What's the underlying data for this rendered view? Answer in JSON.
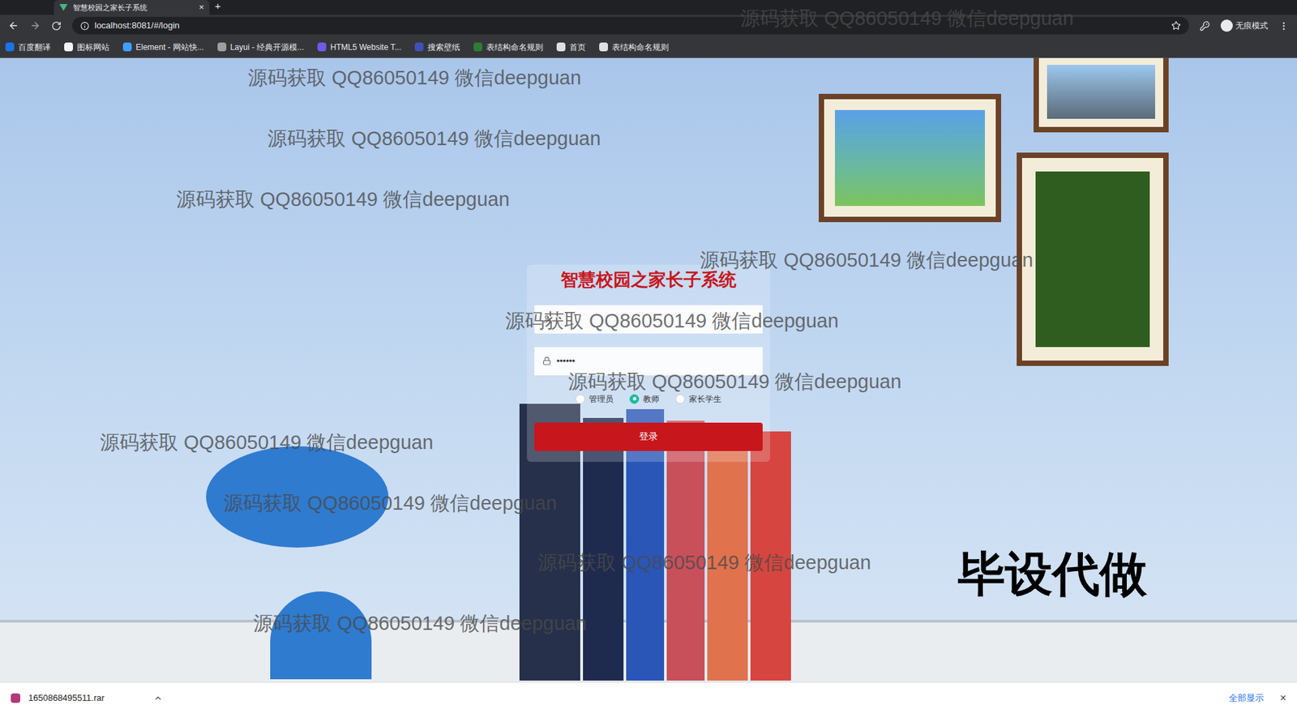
{
  "browser": {
    "tab_title": "智慧校园之家长子系统",
    "tab_close": "×",
    "new_tab": "+",
    "url": "localhost:8081/#/login",
    "profile": "无痕模式"
  },
  "bookmarks": [
    {
      "label": "百度翻译",
      "color": "#1a73e8"
    },
    {
      "label": "图标网站",
      "color": "#f5f5f5"
    },
    {
      "label": "Element - 网站快...",
      "color": "#409eff"
    },
    {
      "label": "Layui - 经典开源模...",
      "color": "#9e9e9e"
    },
    {
      "label": "HTML5 Website T...",
      "color": "#6c5ce7"
    },
    {
      "label": "搜索壁纸",
      "color": "#3f51b5"
    },
    {
      "label": "表结构命名规则",
      "color": "#2e7d32"
    },
    {
      "label": "首页",
      "color": "#e0e0e0"
    },
    {
      "label": "表结构命名规则",
      "color": "#e0e0e0"
    }
  ],
  "login": {
    "title": "智慧校园之家长子系统",
    "password_mask": "••••••",
    "roles": [
      {
        "label": "管理员",
        "selected": false
      },
      {
        "label": "教师",
        "selected": true
      },
      {
        "label": "家长学生",
        "selected": false
      }
    ],
    "button": "登录"
  },
  "downloads": {
    "file": "1650868495511.rar",
    "show_all": "全部显示",
    "close": "×"
  },
  "watermarks": [
    {
      "text": "源码获取 QQ86050149 微信deepguan"
    },
    {
      "text": "源码获取 QQ86050149 微信deepguan"
    },
    {
      "text": "源码获取 QQ86050149 微信deepguan"
    },
    {
      "text": "源码获取 QQ86050149 微信deepguan"
    },
    {
      "text": "源码获取 QQ86050149 微信deepguan"
    },
    {
      "text": "源码获取 QQ86050149 微信deepguan"
    },
    {
      "text": "源码获取 QQ86050149 微信deepguan"
    },
    {
      "text": "源码获取 QQ86050149 微信deepguan"
    },
    {
      "text": "源码获取 QQ86050149 微信deepguan"
    },
    {
      "text": "源码获取 QQ86050149 微信deepguan"
    },
    {
      "text": "源码获取 QQ86050149 微信deepguan"
    }
  ],
  "ad_text": "毕设代做"
}
